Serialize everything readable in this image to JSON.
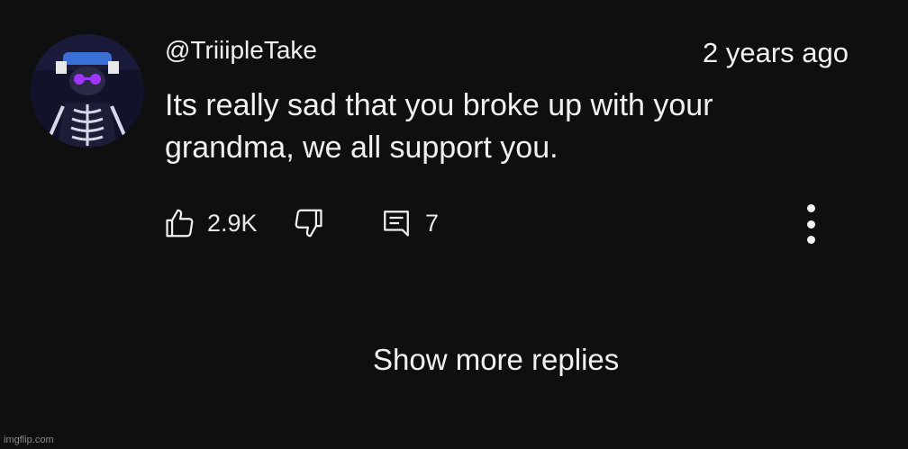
{
  "comment": {
    "author": "@TriiipleTake",
    "timestamp": "2 years ago",
    "text": "Its really sad that you broke up with your grandma, we all support you.",
    "avatar_icon": "skeleton-avatar"
  },
  "actions": {
    "like_icon": "thumbs-up-icon",
    "like_count": "2.9K",
    "dislike_icon": "thumbs-down-icon",
    "reply_icon": "comment-icon",
    "reply_count": "7",
    "more_icon": "more-vertical-icon"
  },
  "replies": {
    "show_more_label": "Show more replies"
  },
  "watermark": "imgflip.com",
  "colors": {
    "background": "#0f0f0f",
    "text": "#f1f1f1",
    "avatar_accent": "#8a2be2"
  }
}
